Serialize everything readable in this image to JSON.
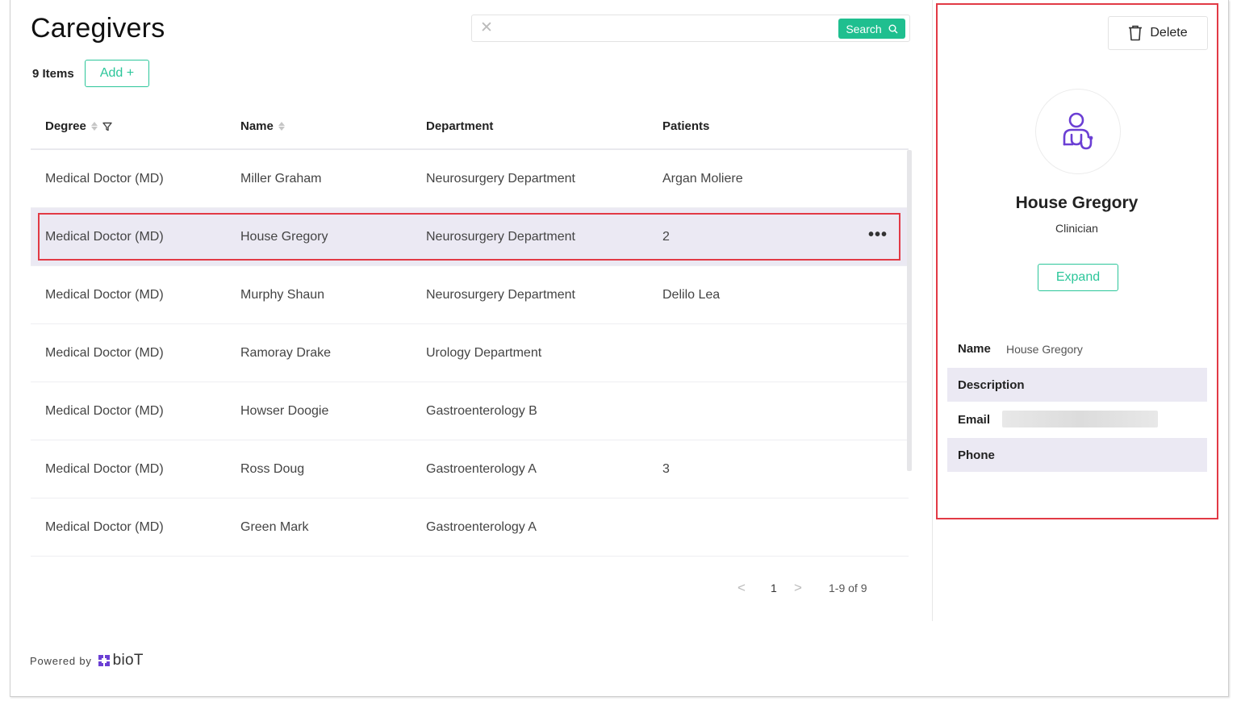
{
  "page": {
    "title": "Caregivers"
  },
  "search": {
    "clear_icon": "close-icon",
    "button_label": "Search",
    "button_icon": "search-icon"
  },
  "toolbar": {
    "items_count": "9 Items",
    "add_label": "Add +"
  },
  "table": {
    "headers": {
      "degree": "Degree",
      "name": "Name",
      "department": "Department",
      "patients": "Patients"
    },
    "rows": [
      {
        "degree": "Medical Doctor (MD)",
        "name": "Miller Graham",
        "department": "Neurosurgery Department",
        "patients": "Argan Moliere"
      },
      {
        "degree": "Medical Doctor (MD)",
        "name": "House Gregory",
        "department": "Neurosurgery Department",
        "patients": "2",
        "more": "•••"
      },
      {
        "degree": "Medical Doctor (MD)",
        "name": "Murphy Shaun",
        "department": "Neurosurgery Department",
        "patients": "Delilo Lea"
      },
      {
        "degree": "Medical Doctor (MD)",
        "name": "Ramoray Drake",
        "department": "Urology Department",
        "patients": ""
      },
      {
        "degree": "Medical Doctor (MD)",
        "name": "Howser Doogie",
        "department": "Gastroenterology B",
        "patients": ""
      },
      {
        "degree": "Medical Doctor (MD)",
        "name": "Ross Doug",
        "department": "Gastroenterology A",
        "patients": "3"
      },
      {
        "degree": "Medical Doctor (MD)",
        "name": "Green Mark",
        "department": "Gastroenterology A",
        "patients": ""
      }
    ]
  },
  "pagination": {
    "prev": "<",
    "page": "1",
    "next": ">",
    "range": "1-9 of 9"
  },
  "footer": {
    "powered_by": "Powered by",
    "brand": "bioT"
  },
  "details": {
    "delete_label": "Delete",
    "name": "House Gregory",
    "role": "Clinician",
    "expand_label": "Expand",
    "fields": {
      "name_label": "Name",
      "name_value": "House Gregory",
      "description_label": "Description",
      "email_label": "Email",
      "phone_label": "Phone"
    }
  },
  "colors": {
    "accent": "#1fbf8f",
    "highlight": "#e23a45",
    "selected_row": "#ebe9f3",
    "brand": "#6b3fd4"
  }
}
